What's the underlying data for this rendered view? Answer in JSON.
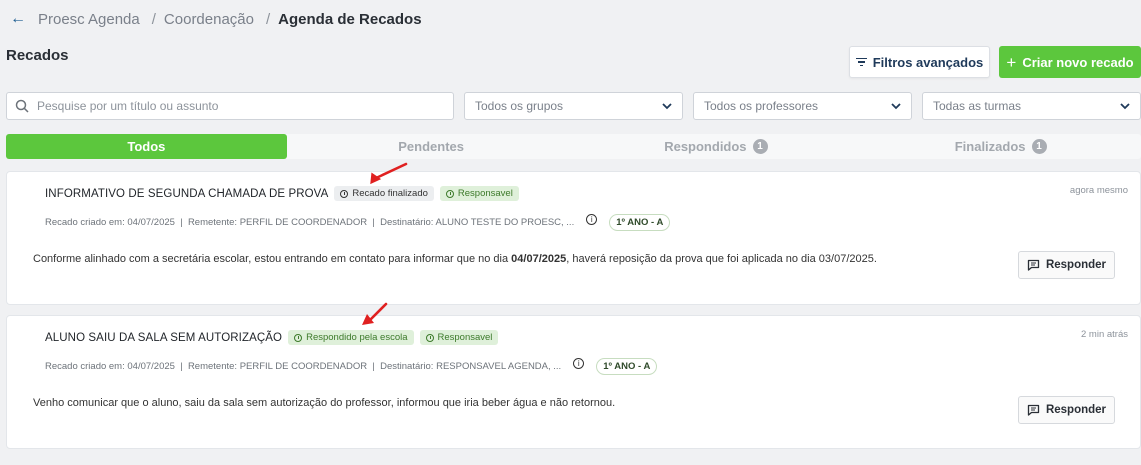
{
  "breadcrumb": {
    "items": [
      "Proesc Agenda",
      "Coordenação"
    ],
    "separator": "/",
    "current": "Agenda de Recados"
  },
  "page": {
    "title": "Recados"
  },
  "actions": {
    "filters_label": "Filtros avançados",
    "new_label": "Criar novo recado"
  },
  "search": {
    "placeholder": "Pesquise por um título ou assunto",
    "value": ""
  },
  "filters": {
    "groups": "Todos os grupos",
    "teachers": "Todos os professores",
    "classes": "Todas as turmas"
  },
  "tabs": [
    {
      "label": "Todos",
      "count": ""
    },
    {
      "label": "Pendentes",
      "count": ""
    },
    {
      "label": "Respondidos",
      "count": "1"
    },
    {
      "label": "Finalizados",
      "count": "1"
    }
  ],
  "messages": [
    {
      "title": "INFORMATIVO DE SEGUNDA CHAMADA DE PROVA",
      "status": "Recado finalizado",
      "role": "Responsavel",
      "time": "agora mesmo",
      "meta": "Recado criado em: 04/07/2025  |  Remetente: PERFIL DE COORDENADOR  |  Destinatário: ALUNO TESTE DO PROESC, ...",
      "class": "1º ANO - A",
      "body_pre": "Conforme alinhado com a secretária escolar, estou entrando em contato para informar que no dia ",
      "body_bold": "04/07/2025",
      "body_post": ", haverá reposição da prova que foi aplicada no dia 03/07/2025.",
      "reply_label": "Responder"
    },
    {
      "title": "ALUNO SAIU DA SALA SEM AUTORIZAÇÃO",
      "status": "Respondido pela escola",
      "role": "Responsavel",
      "time": "2 min atrás",
      "meta": "Recado criado em: 04/07/2025  |  Remetente: PERFIL DE COORDENADOR  |  Destinatário: RESPONSAVEL AGENDA, ...",
      "class": "1º ANO - A",
      "body": "Venho comunicar que o aluno, saiu da sala sem autorização do professor, informou que iria beber água e não retornou.",
      "reply_label": "Responder"
    }
  ],
  "colors": {
    "accent": "#5cc73d",
    "annotation": "#e02020",
    "text": "#2a2f36"
  }
}
